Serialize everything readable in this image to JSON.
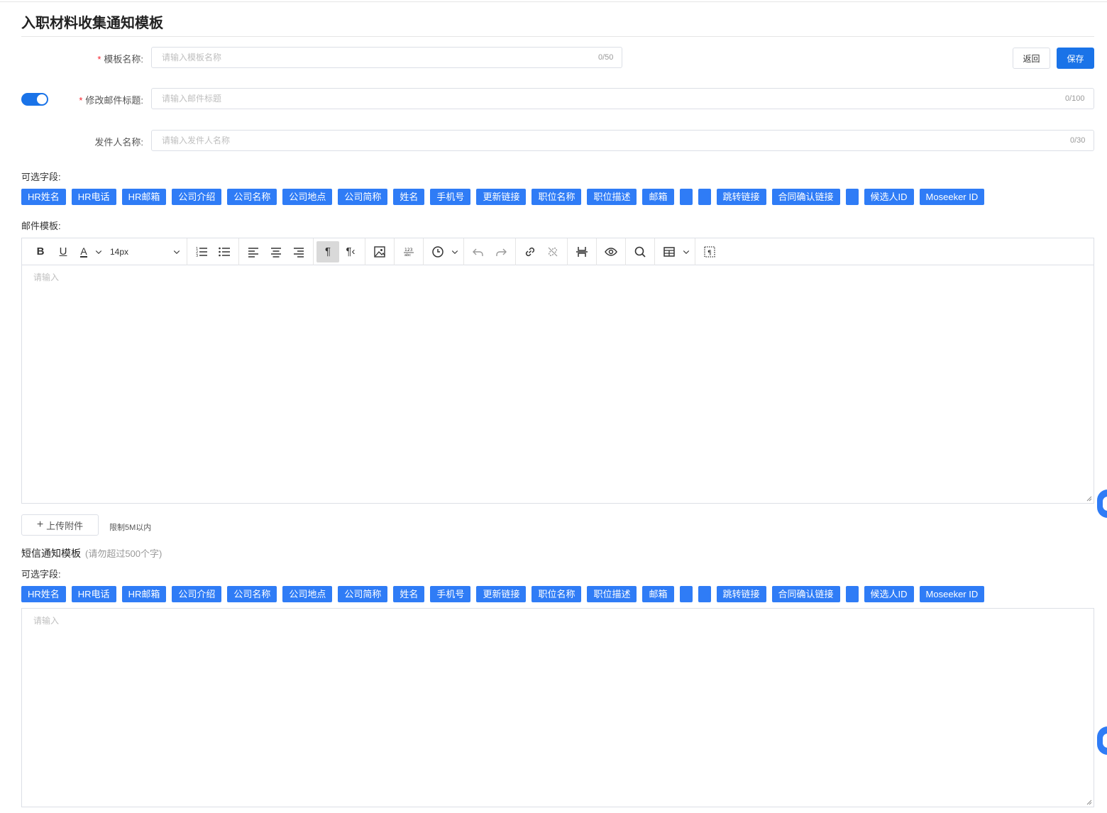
{
  "page": {
    "title": "入职材料收集通知模板"
  },
  "form": {
    "template_name": {
      "label": "模板名称:",
      "placeholder": "请输入模板名称",
      "value": "",
      "counter": "0/50"
    },
    "email_subject": {
      "label": "修改邮件标题:",
      "placeholder": "请输入邮件标题",
      "value": "",
      "counter": "0/100"
    },
    "sender_name": {
      "label": "发件人名称:",
      "placeholder": "请输入发件人名称",
      "value": "",
      "counter": "0/30"
    },
    "toggle_on": true
  },
  "actions": {
    "back_label": "返回",
    "save_label": "保存"
  },
  "fields_label": "可选字段:",
  "fields": [
    "HR姓名",
    "HR电话",
    "HR邮箱",
    "公司介绍",
    "公司名称",
    "公司地点",
    "公司简称",
    "姓名",
    "手机号",
    "更新链接",
    "职位名称",
    "职位描述",
    "邮箱",
    "",
    "",
    "跳转链接",
    "合同确认链接",
    "",
    "候选人ID",
    "Moseeker ID"
  ],
  "email_template": {
    "label": "邮件模板:",
    "font_size": "14px",
    "placeholder": "请输入"
  },
  "upload": {
    "button_label": "上传附件",
    "hint": "限制5M以内"
  },
  "sms": {
    "title": "短信通知模板",
    "hint": "(请勿超过500个字)",
    "fields_label": "可选字段:",
    "placeholder": "请输入"
  },
  "colors": {
    "primary": "#1a73e8",
    "tag": "#2f7cf6",
    "required": "#f5222d"
  }
}
